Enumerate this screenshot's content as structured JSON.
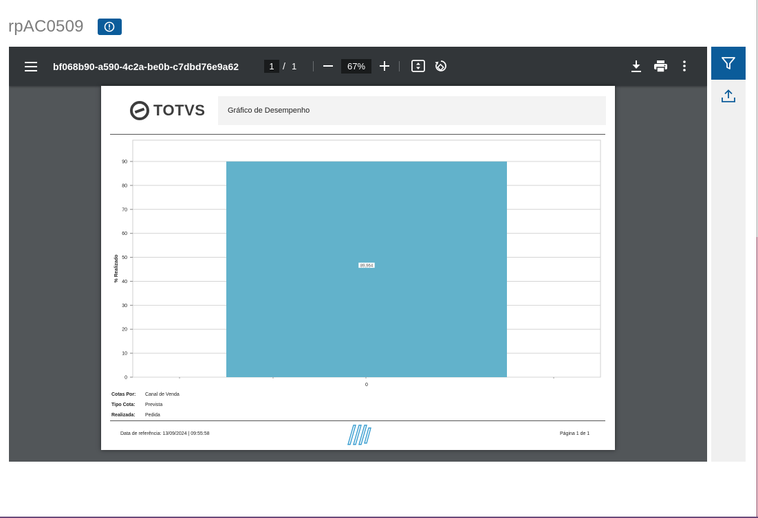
{
  "page": {
    "title": "rpAC0509"
  },
  "icons": {
    "info": "info-circle-icon",
    "menu": "hamburger-menu-icon",
    "zoom_out": "minus-icon",
    "zoom_in": "plus-icon",
    "fit": "fit-page-icon",
    "rotate": "rotate-icon",
    "download": "download-icon",
    "print": "print-icon",
    "more": "more-vertical-icon",
    "filter": "filter-icon",
    "upload": "upload-icon"
  },
  "viewer": {
    "document_name": "bf068b90-a590-4c2a-be0b-c7dbd76e9a62",
    "current_page": "1",
    "page_separator": "/",
    "total_pages": "1",
    "zoom": "67%"
  },
  "report": {
    "brand": "TOTVS",
    "header_title": "Gráfico de Desempenho",
    "filters": [
      {
        "label": "Cotas Por:",
        "value": "Canal de Venda"
      },
      {
        "label": "Tipo Cota:",
        "value": "Prevista"
      },
      {
        "label": "Realizada:",
        "value": "Pedida"
      }
    ],
    "footer": {
      "date_label": "Data de referência:",
      "date_value": "13/09/2024 | 09:55:58",
      "page_text": "Página  1  de  1"
    }
  },
  "chart_data": {
    "type": "bar",
    "categories": [
      "0"
    ],
    "values": [
      89.964
    ],
    "data_labels": [
      "89,964"
    ],
    "title": "",
    "xlabel": "",
    "ylabel": "% Realizado",
    "ylim": [
      0,
      90
    ],
    "yticks": [
      0,
      10,
      20,
      30,
      40,
      50,
      60,
      70,
      80,
      90
    ],
    "grid": true,
    "bar_color": "#62b2cb"
  },
  "colors": {
    "accent": "#0b5c9a",
    "toolbar": "#323639",
    "viewer_bg": "#525659",
    "bar": "#62b2cb"
  }
}
